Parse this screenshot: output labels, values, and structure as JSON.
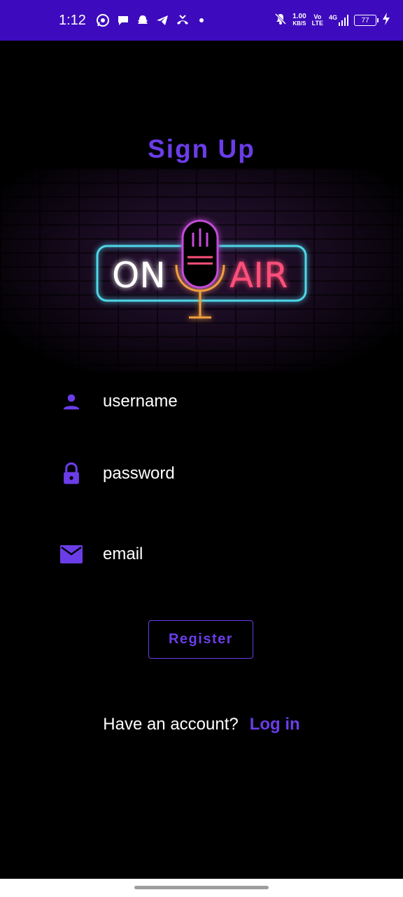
{
  "status_bar": {
    "time": "1:12",
    "speed_value": "1.00",
    "speed_unit": "KB/S",
    "volte_top": "Vo",
    "volte_bottom": "LTE",
    "network": "4G",
    "battery": "77",
    "icons": [
      "whatsapp-icon",
      "chat-icon",
      "snapchat-icon",
      "telegram-icon",
      "missed-call-icon",
      "mute-icon",
      "signal-icon",
      "charging-icon"
    ]
  },
  "page": {
    "title": "Sign Up",
    "banner_text_left": "ON",
    "banner_text_right": "AIR"
  },
  "form": {
    "username_placeholder": "username",
    "password_placeholder": "password",
    "email_placeholder": "email",
    "register_label": "Register"
  },
  "footer": {
    "question": "Have an account?",
    "login_label": "Log in"
  },
  "colors": {
    "accent": "#6a3de8",
    "status_bar": "#3d0bbd",
    "background": "#000000"
  }
}
